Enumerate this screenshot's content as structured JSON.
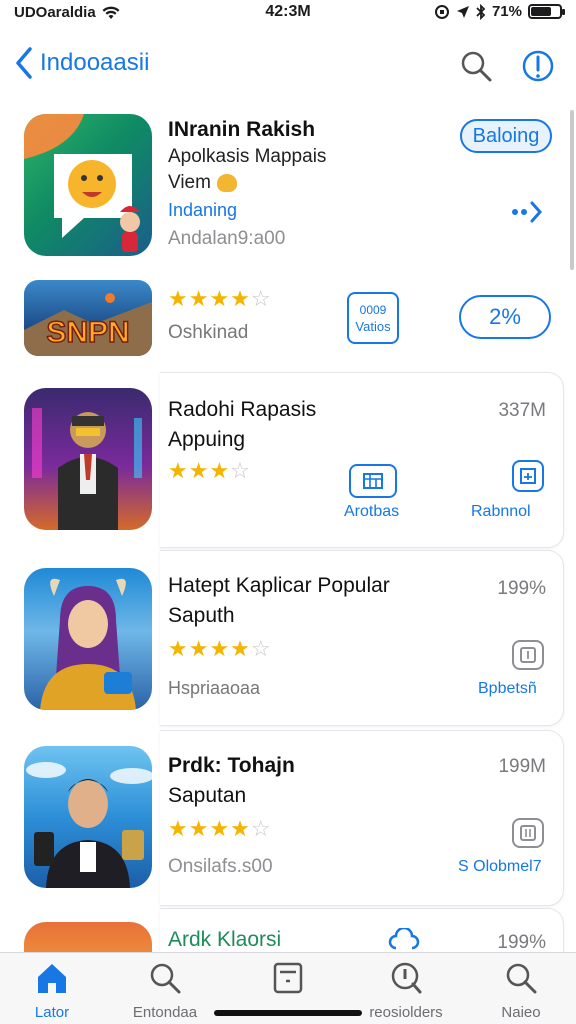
{
  "status_bar": {
    "carrier": "UDOaraldia",
    "time": "42:3M",
    "battery": "71%",
    "battery_level": 0.71
  },
  "nav": {
    "back_label": "Indooaasii"
  },
  "featured": {
    "title": "INranin Rakish",
    "subtitle_line1": "Apolkasis Mappais",
    "subtitle_line2": "Viem",
    "category": "Indaning",
    "meta": "Andalan9:a00",
    "button": "Baloing"
  },
  "banner": {
    "logo_text": "SNPN",
    "rating": 4,
    "label": "Oshkinad",
    "mini_button": "0009",
    "mini_button_sub": "Vatios",
    "pill": "2%"
  },
  "items": [
    {
      "title_line1": "Radohi Rapasis",
      "title_line2": "Appuing",
      "rating": 3,
      "size": "337M",
      "action1": "Arotbas",
      "action2": "Rabnnol"
    },
    {
      "title_line1": "Hatept Kaplicar Popular",
      "title_line2": "Saputh",
      "rating": 4,
      "size": "199%",
      "meta": "Hspriaaoaa",
      "action2": "Bpbetsñ"
    },
    {
      "title_line1": "Prdk: Tohajn",
      "title_line2": "Saputan",
      "rating": 4,
      "size": "199M",
      "meta": "Onsilafs.s00",
      "action2": "S Olobmel7"
    },
    {
      "title_line1": "Ardk Klaorsi",
      "size": "199%"
    }
  ],
  "tabs": [
    {
      "label": "Lator",
      "icon": "home-icon"
    },
    {
      "label": "Entondaa",
      "icon": "search-icon"
    },
    {
      "label": "",
      "icon": "browse-icon"
    },
    {
      "label": "reosiolders",
      "icon": "info-icon"
    },
    {
      "label": "Naieo",
      "icon": "search-icon"
    }
  ],
  "colors": {
    "accent": "#1677e5",
    "star": "#f4b400"
  }
}
